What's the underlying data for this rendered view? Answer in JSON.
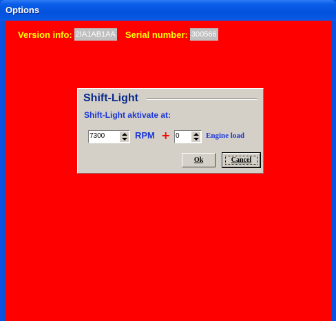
{
  "window": {
    "title": "Options"
  },
  "info": {
    "version_label": "Version info:",
    "version_value": "2IA1AB1AA",
    "serial_label": "Serial number:",
    "serial_value": "300566"
  },
  "shift_light": {
    "group_title": "Shift-Light",
    "subtitle": "Shift-Light aktivate at:",
    "rpm_value": "7300",
    "rpm_unit": "RPM",
    "plus_symbol": "+",
    "load_value": "0",
    "load_label": "Engine load",
    "ok_label": "Ok",
    "cancel_label": "Cancel"
  },
  "colors": {
    "client_background": "#ff0000",
    "info_text": "#ffff00",
    "dialog_title": "#0a2a8a",
    "dialog_text": "#1a36d8"
  },
  "icons": {
    "spin_up": "arrow-up-icon",
    "spin_down": "arrow-down-icon",
    "plus": "plus-icon"
  }
}
